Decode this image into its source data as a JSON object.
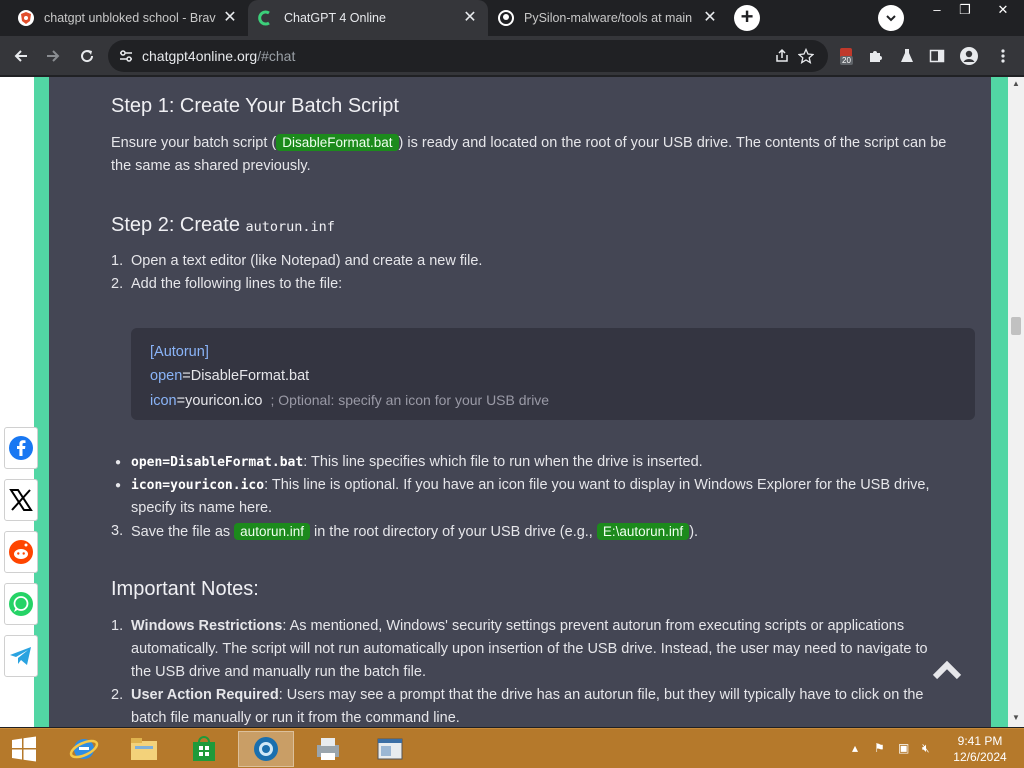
{
  "browser": {
    "tabs": [
      {
        "title": "chatgpt unbloked school - Brave",
        "active": false
      },
      {
        "title": "ChatGPT 4 Online",
        "active": true
      },
      {
        "title": "PySilon-malware/tools at main ·",
        "active": false
      }
    ],
    "address": {
      "host": "chatgpt4online.org",
      "path": "/#chat"
    },
    "extension_badge": "20"
  },
  "article": {
    "step1_heading": "Step 1: Create Your Batch Script",
    "step1_text_before": "Ensure your batch script (",
    "step1_code": "DisableFormat.bat",
    "step1_text_after": ") is ready and located on the root of your USB drive. The contents of the script can be",
    "step1_text_line2": "the same as shared previously.",
    "step2_heading_text": "Step 2: Create ",
    "step2_heading_code": "autorun.inf",
    "step2_items": [
      "Open a text editor (like Notepad) and create a new file.",
      "Add the following lines to the file:"
    ],
    "codeblock": {
      "line1": "[Autorun]",
      "line2_key": "open",
      "line2_val": "DisableFormat.bat",
      "line3_key": "icon",
      "line3_val": "youricon.ico",
      "line3_comment": "; Optional: specify an icon for your USB drive"
    },
    "bullets": [
      {
        "code": "open=DisableFormat.bat",
        "text": ": This line specifies which file to run when the drive is inserted."
      },
      {
        "code": "icon=youricon.ico",
        "text": ": This line is optional. If you have an icon file you want to display in Windows Explorer for the USB drive,",
        "text2": "specify its name here."
      }
    ],
    "step3": {
      "before": "Save the file as ",
      "code1": "autorun.inf",
      "middle": " in the root directory of your USB drive (e.g., ",
      "code2": "E:\\autorun.inf",
      "after": ")."
    },
    "notes_heading": "Important Notes:",
    "notes": [
      {
        "bold": "Windows Restrictions",
        "line1": ": As mentioned, Windows' security settings prevent autorun from executing scripts or applications",
        "line2": "automatically. The script will not run automatically upon insertion of the USB drive. Instead, the user may need to navigate to",
        "line3": "the USB drive and manually run the batch file."
      },
      {
        "bold": "User Action Required",
        "line1": ": Users may see a prompt that the drive has an autorun file, but they will typically have to click on the",
        "line2": "batch file manually or run it from the command line."
      }
    ]
  },
  "taskbar": {
    "clock_time": "9:41 PM",
    "clock_date": "12/6/2024"
  }
}
